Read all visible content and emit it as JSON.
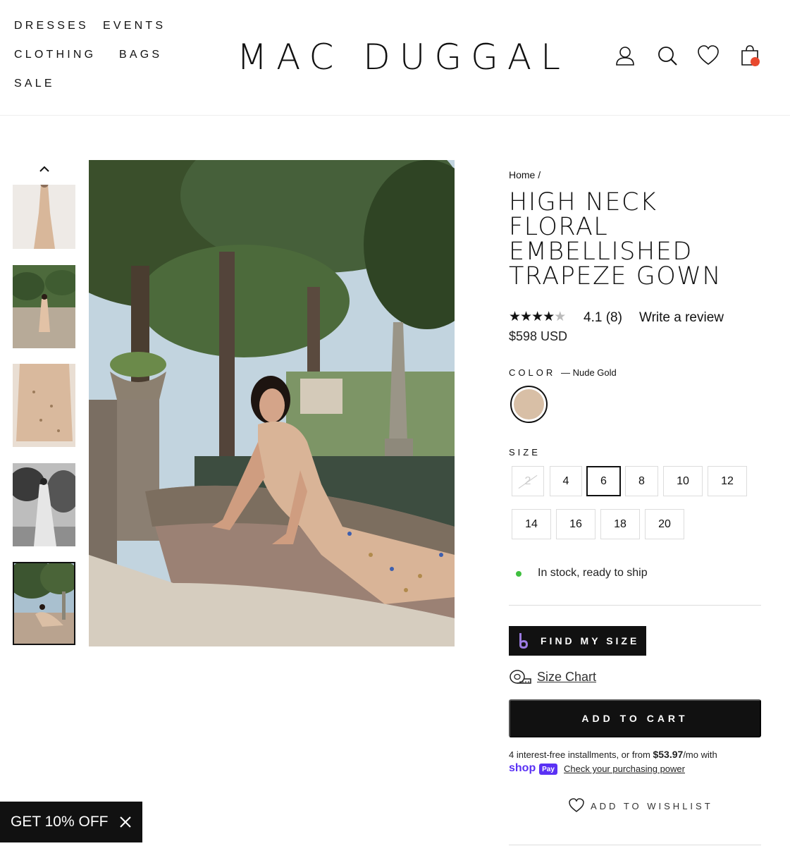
{
  "nav": {
    "dresses": "DRESSES",
    "events": "EVENTS",
    "clothing": "CLOTHING",
    "bags": "BAGS",
    "sale": "SALE"
  },
  "brand": "MAC DUGGAL",
  "header_icons": [
    "user-icon",
    "search-icon",
    "heart-icon",
    "cart-icon"
  ],
  "breadcrumb": {
    "home": "Home",
    "separator": "/"
  },
  "product": {
    "title": "HIGH NECK FLORAL EMBELLISHED TRAPEZE GOWN",
    "rating_stars": 4.1,
    "rating_text": "4.1 (8)",
    "write_review": "Write a review",
    "price": "$598 USD"
  },
  "color": {
    "label": "COLOR",
    "value": "— Nude Gold",
    "swatch_hex": "#d8bfa6"
  },
  "size": {
    "label": "SIZE",
    "options": [
      "2",
      "4",
      "6",
      "8",
      "10",
      "12",
      "14",
      "16",
      "18",
      "20"
    ],
    "selected": "6",
    "unavailable": [
      "2"
    ]
  },
  "stock": {
    "text": "In stock, ready to ship",
    "color": "#3fbf3f"
  },
  "find_my_size": "FIND MY SIZE",
  "size_chart": "Size Chart",
  "add_to_cart": "ADD TO CART",
  "installments": {
    "prefix": "4 interest-free installments, or from",
    "amount": "$53.97",
    "suffix": "/mo with",
    "shop": "shop",
    "pay": "Pay",
    "link": "Check your purchasing power"
  },
  "wishlist": "ADD TO WISHLIST",
  "promo": "GET 10% OFF",
  "colors": {
    "accent": "#111111",
    "cart_dot": "#e8492f",
    "shop_pay": "#5a31f4"
  }
}
